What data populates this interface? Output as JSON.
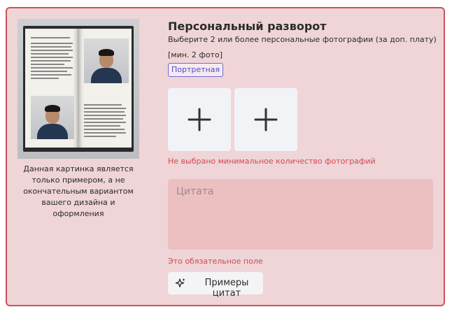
{
  "card": {
    "title": "Персональный разворот",
    "subtitle": "Выберите 2 или более персональные фотографии (за доп. плату)",
    "min_note": "[мин. 2 фото]",
    "tag": "Портретная",
    "preview_caption": "Данная картинка является только примером, а не окончательным вариантом вашего дизайна и оформления",
    "photo_error": "Не выбрано минимальное количество фотографий",
    "quote_placeholder": "Цитата",
    "required_error": "Это обязательное поле",
    "examples_button": "Примеры цитат"
  },
  "colors": {
    "card_bg": "#efd5d7",
    "card_border": "#d0505a",
    "error": "#cf4b52",
    "tag_text": "#4b4bd6",
    "quote_bg": "#ecbfc1"
  },
  "icons": {
    "upload_slot": "plus-icon",
    "examples": "sparkle-icon"
  }
}
